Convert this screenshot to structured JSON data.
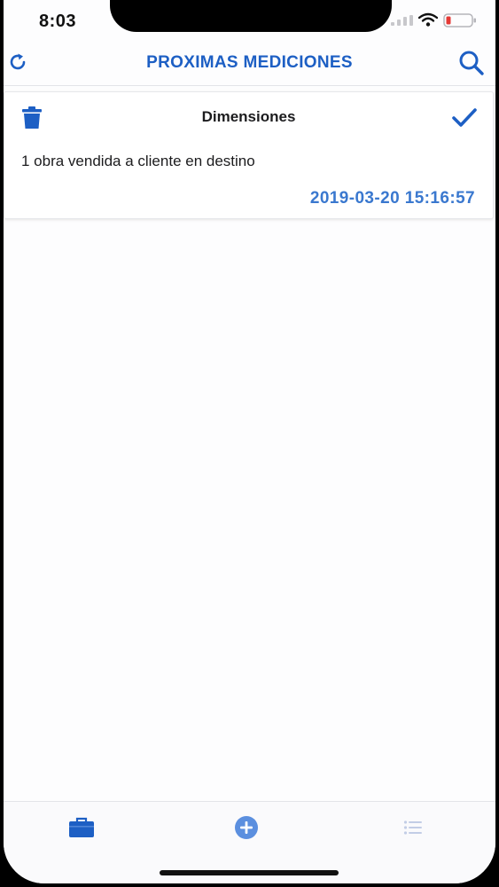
{
  "status_bar": {
    "time": "8:03",
    "icons": [
      "signal-icon",
      "wifi-icon",
      "battery-low-icon"
    ],
    "battery_color": "#e53935"
  },
  "navbar": {
    "title": "PROXIMAS MEDICIONES",
    "left_icon": "refresh-icon",
    "right_icon": "search-icon"
  },
  "cards": [
    {
      "title": "Dimensiones",
      "description": "1 obra vendida a cliente en destino",
      "datetime": "2019-03-20 15:16:57",
      "left_icon": "trash-icon",
      "right_icon": "checkmark-icon"
    }
  ],
  "tabbar": {
    "tabs": [
      {
        "icon": "briefcase-icon",
        "active": true
      },
      {
        "icon": "plus-circle-icon",
        "active": false
      },
      {
        "icon": "list-icon",
        "active": false
      }
    ]
  },
  "colors": {
    "accent": "#1d5fc4",
    "date": "#3a78cf",
    "background": "#fdfdfe",
    "text": "#1c1c1e"
  }
}
